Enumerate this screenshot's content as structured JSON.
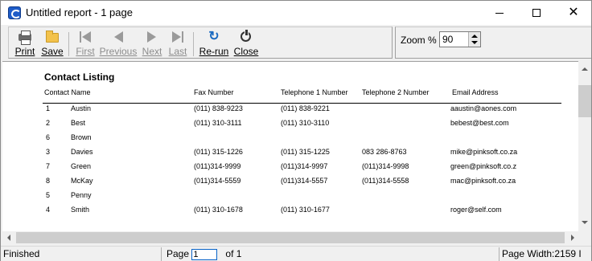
{
  "window": {
    "title": "Untitled report - 1 page",
    "controls": {
      "minimize": "minimize-icon",
      "maximize": "maximize-icon",
      "close": "close-icon"
    }
  },
  "toolbar": {
    "print_label": "Print",
    "save_label": "Save",
    "first_label": "First",
    "previous_label": "Previous",
    "next_label": "Next",
    "last_label": "Last",
    "rerun_label": "Re-run",
    "close_label": "Close",
    "zoom_label": "Zoom % :",
    "zoom_value": "90"
  },
  "report": {
    "title": "Contact Listing",
    "headers": {
      "contact_name": "Contact Name",
      "fax": "Fax Number",
      "tel1": "Telephone 1 Number",
      "tel2": "Telephone 2 Number",
      "email": "Email Address"
    },
    "rows": [
      {
        "id": "1",
        "name": "Austin",
        "fax": "(011) 838-9223",
        "tel1": "(011) 838-9221",
        "tel2": "",
        "email": "aaustin@aones.com"
      },
      {
        "id": "2",
        "name": "Best",
        "fax": "(011) 310-3111",
        "tel1": "(011) 310-3110",
        "tel2": "",
        "email": "bebest@best.com"
      },
      {
        "id": "6",
        "name": "Brown",
        "fax": "",
        "tel1": "",
        "tel2": "",
        "email": ""
      },
      {
        "id": "3",
        "name": "Davies",
        "fax": "(011) 315-1226",
        "tel1": "(011) 315-1225",
        "tel2": "083 286-8763",
        "email": "mike@pinksoft.co.za"
      },
      {
        "id": "7",
        "name": "Green",
        "fax": "(011)314-9999",
        "tel1": "(011)314-9997",
        "tel2": "(011)314-9998",
        "email": "green@pinksoft.co.z"
      },
      {
        "id": "8",
        "name": "McKay",
        "fax": "(011)314-5559",
        "tel1": "(011)314-5557",
        "tel2": "(011)314-5558",
        "email": "mac@pinksoft.co.za"
      },
      {
        "id": "5",
        "name": "Penny",
        "fax": "",
        "tel1": "",
        "tel2": "",
        "email": ""
      },
      {
        "id": "4",
        "name": "Smith",
        "fax": "(011) 310-1678",
        "tel1": "(011) 310-1677",
        "tel2": "",
        "email": "roger@self.com"
      }
    ]
  },
  "statusbar": {
    "status": "Finished",
    "page_label": "Page",
    "page_value": "1",
    "of_label": "of 1",
    "page_width": "Page Width:2159 I"
  }
}
